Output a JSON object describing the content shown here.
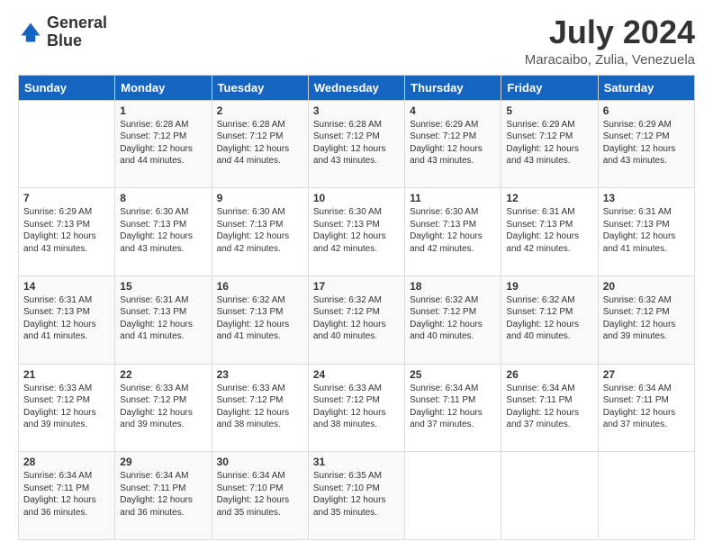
{
  "logo": {
    "line1": "General",
    "line2": "Blue"
  },
  "header": {
    "month_year": "July 2024",
    "location": "Maracaibo, Zulia, Venezuela"
  },
  "days_of_week": [
    "Sunday",
    "Monday",
    "Tuesday",
    "Wednesday",
    "Thursday",
    "Friday",
    "Saturday"
  ],
  "weeks": [
    [
      {
        "day": "",
        "sunrise": "",
        "sunset": "",
        "daylight": ""
      },
      {
        "day": "1",
        "sunrise": "Sunrise: 6:28 AM",
        "sunset": "Sunset: 7:12 PM",
        "daylight": "Daylight: 12 hours and 44 minutes."
      },
      {
        "day": "2",
        "sunrise": "Sunrise: 6:28 AM",
        "sunset": "Sunset: 7:12 PM",
        "daylight": "Daylight: 12 hours and 44 minutes."
      },
      {
        "day": "3",
        "sunrise": "Sunrise: 6:28 AM",
        "sunset": "Sunset: 7:12 PM",
        "daylight": "Daylight: 12 hours and 43 minutes."
      },
      {
        "day": "4",
        "sunrise": "Sunrise: 6:29 AM",
        "sunset": "Sunset: 7:12 PM",
        "daylight": "Daylight: 12 hours and 43 minutes."
      },
      {
        "day": "5",
        "sunrise": "Sunrise: 6:29 AM",
        "sunset": "Sunset: 7:12 PM",
        "daylight": "Daylight: 12 hours and 43 minutes."
      },
      {
        "day": "6",
        "sunrise": "Sunrise: 6:29 AM",
        "sunset": "Sunset: 7:12 PM",
        "daylight": "Daylight: 12 hours and 43 minutes."
      }
    ],
    [
      {
        "day": "7",
        "sunrise": "Sunrise: 6:29 AM",
        "sunset": "Sunset: 7:13 PM",
        "daylight": "Daylight: 12 hours and 43 minutes."
      },
      {
        "day": "8",
        "sunrise": "Sunrise: 6:30 AM",
        "sunset": "Sunset: 7:13 PM",
        "daylight": "Daylight: 12 hours and 43 minutes."
      },
      {
        "day": "9",
        "sunrise": "Sunrise: 6:30 AM",
        "sunset": "Sunset: 7:13 PM",
        "daylight": "Daylight: 12 hours and 42 minutes."
      },
      {
        "day": "10",
        "sunrise": "Sunrise: 6:30 AM",
        "sunset": "Sunset: 7:13 PM",
        "daylight": "Daylight: 12 hours and 42 minutes."
      },
      {
        "day": "11",
        "sunrise": "Sunrise: 6:30 AM",
        "sunset": "Sunset: 7:13 PM",
        "daylight": "Daylight: 12 hours and 42 minutes."
      },
      {
        "day": "12",
        "sunrise": "Sunrise: 6:31 AM",
        "sunset": "Sunset: 7:13 PM",
        "daylight": "Daylight: 12 hours and 42 minutes."
      },
      {
        "day": "13",
        "sunrise": "Sunrise: 6:31 AM",
        "sunset": "Sunset: 7:13 PM",
        "daylight": "Daylight: 12 hours and 41 minutes."
      }
    ],
    [
      {
        "day": "14",
        "sunrise": "Sunrise: 6:31 AM",
        "sunset": "Sunset: 7:13 PM",
        "daylight": "Daylight: 12 hours and 41 minutes."
      },
      {
        "day": "15",
        "sunrise": "Sunrise: 6:31 AM",
        "sunset": "Sunset: 7:13 PM",
        "daylight": "Daylight: 12 hours and 41 minutes."
      },
      {
        "day": "16",
        "sunrise": "Sunrise: 6:32 AM",
        "sunset": "Sunset: 7:13 PM",
        "daylight": "Daylight: 12 hours and 41 minutes."
      },
      {
        "day": "17",
        "sunrise": "Sunrise: 6:32 AM",
        "sunset": "Sunset: 7:12 PM",
        "daylight": "Daylight: 12 hours and 40 minutes."
      },
      {
        "day": "18",
        "sunrise": "Sunrise: 6:32 AM",
        "sunset": "Sunset: 7:12 PM",
        "daylight": "Daylight: 12 hours and 40 minutes."
      },
      {
        "day": "19",
        "sunrise": "Sunrise: 6:32 AM",
        "sunset": "Sunset: 7:12 PM",
        "daylight": "Daylight: 12 hours and 40 minutes."
      },
      {
        "day": "20",
        "sunrise": "Sunrise: 6:32 AM",
        "sunset": "Sunset: 7:12 PM",
        "daylight": "Daylight: 12 hours and 39 minutes."
      }
    ],
    [
      {
        "day": "21",
        "sunrise": "Sunrise: 6:33 AM",
        "sunset": "Sunset: 7:12 PM",
        "daylight": "Daylight: 12 hours and 39 minutes."
      },
      {
        "day": "22",
        "sunrise": "Sunrise: 6:33 AM",
        "sunset": "Sunset: 7:12 PM",
        "daylight": "Daylight: 12 hours and 39 minutes."
      },
      {
        "day": "23",
        "sunrise": "Sunrise: 6:33 AM",
        "sunset": "Sunset: 7:12 PM",
        "daylight": "Daylight: 12 hours and 38 minutes."
      },
      {
        "day": "24",
        "sunrise": "Sunrise: 6:33 AM",
        "sunset": "Sunset: 7:12 PM",
        "daylight": "Daylight: 12 hours and 38 minutes."
      },
      {
        "day": "25",
        "sunrise": "Sunrise: 6:34 AM",
        "sunset": "Sunset: 7:11 PM",
        "daylight": "Daylight: 12 hours and 37 minutes."
      },
      {
        "day": "26",
        "sunrise": "Sunrise: 6:34 AM",
        "sunset": "Sunset: 7:11 PM",
        "daylight": "Daylight: 12 hours and 37 minutes."
      },
      {
        "day": "27",
        "sunrise": "Sunrise: 6:34 AM",
        "sunset": "Sunset: 7:11 PM",
        "daylight": "Daylight: 12 hours and 37 minutes."
      }
    ],
    [
      {
        "day": "28",
        "sunrise": "Sunrise: 6:34 AM",
        "sunset": "Sunset: 7:11 PM",
        "daylight": "Daylight: 12 hours and 36 minutes."
      },
      {
        "day": "29",
        "sunrise": "Sunrise: 6:34 AM",
        "sunset": "Sunset: 7:11 PM",
        "daylight": "Daylight: 12 hours and 36 minutes."
      },
      {
        "day": "30",
        "sunrise": "Sunrise: 6:34 AM",
        "sunset": "Sunset: 7:10 PM",
        "daylight": "Daylight: 12 hours and 35 minutes."
      },
      {
        "day": "31",
        "sunrise": "Sunrise: 6:35 AM",
        "sunset": "Sunset: 7:10 PM",
        "daylight": "Daylight: 12 hours and 35 minutes."
      },
      {
        "day": "",
        "sunrise": "",
        "sunset": "",
        "daylight": ""
      },
      {
        "day": "",
        "sunrise": "",
        "sunset": "",
        "daylight": ""
      },
      {
        "day": "",
        "sunrise": "",
        "sunset": "",
        "daylight": ""
      }
    ]
  ]
}
